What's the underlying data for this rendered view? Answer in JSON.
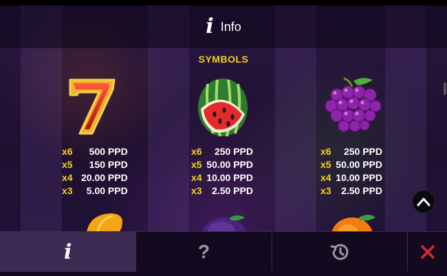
{
  "header": {
    "title": "Info",
    "icon": "info-icon"
  },
  "section": {
    "title": "SYMBOLS"
  },
  "symbols": [
    {
      "name": "seven",
      "icon": "seven-icon",
      "payouts": [
        {
          "mult": "x6",
          "amount": "500 PPD"
        },
        {
          "mult": "x5",
          "amount": "150 PPD"
        },
        {
          "mult": "x4",
          "amount": "20.00 PPD"
        },
        {
          "mult": "x3",
          "amount": "5.00 PPD"
        }
      ]
    },
    {
      "name": "watermelon",
      "icon": "watermelon-icon",
      "payouts": [
        {
          "mult": "x6",
          "amount": "250 PPD"
        },
        {
          "mult": "x5",
          "amount": "50.00 PPD"
        },
        {
          "mult": "x4",
          "amount": "10.00 PPD"
        },
        {
          "mult": "x3",
          "amount": "2.50 PPD"
        }
      ]
    },
    {
      "name": "grapes",
      "icon": "grapes-icon",
      "payouts": [
        {
          "mult": "x6",
          "amount": "250 PPD"
        },
        {
          "mult": "x5",
          "amount": "50.00 PPD"
        },
        {
          "mult": "x4",
          "amount": "10.00 PPD"
        },
        {
          "mult": "x3",
          "amount": "2.50 PPD"
        }
      ]
    }
  ],
  "bottom_tabs": [
    {
      "name": "info",
      "icon": "info-icon",
      "glyph": "i",
      "active": true
    },
    {
      "name": "help",
      "icon": "question-icon",
      "glyph": "?",
      "active": false
    },
    {
      "name": "history",
      "icon": "history-icon",
      "active": false
    },
    {
      "name": "close",
      "icon": "close-icon",
      "active": false
    }
  ],
  "colors": {
    "accent_yellow": "#f5d21d",
    "close_red": "#e0262b",
    "panel_bg": "#140a20",
    "active_tab": "#3b2a52"
  }
}
